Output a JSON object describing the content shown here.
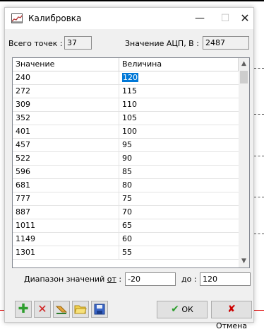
{
  "window": {
    "title": "Калибровка",
    "minimize_glyph": "—",
    "maximize_glyph": "☐",
    "close_glyph": "✕"
  },
  "info": {
    "points_label": "Всего точек :",
    "points_value": "37",
    "adc_label": "Значение АЦП, В :",
    "adc_value": "2487"
  },
  "table": {
    "columns": [
      "Значение",
      "Величина"
    ],
    "rows": [
      [
        "240",
        "120"
      ],
      [
        "272",
        "115"
      ],
      [
        "309",
        "110"
      ],
      [
        "352",
        "105"
      ],
      [
        "401",
        "100"
      ],
      [
        "457",
        "95"
      ],
      [
        "522",
        "90"
      ],
      [
        "596",
        "85"
      ],
      [
        "681",
        "80"
      ],
      [
        "777",
        "75"
      ],
      [
        "887",
        "70"
      ],
      [
        "1011",
        "65"
      ],
      [
        "1149",
        "60"
      ],
      [
        "1301",
        "55"
      ]
    ],
    "selected_row": 0
  },
  "range": {
    "label_prefix": "Диапазон значений ",
    "label_underlined": "от",
    "label_suffix": " :",
    "from_value": "-20",
    "to_label": "до :",
    "to_value": "120"
  },
  "toolbar": {
    "icons": [
      "add-row-icon",
      "delete-row-icon",
      "clear-icon",
      "open-file-icon",
      "save-icon"
    ],
    "ok_label": "ОК",
    "cancel_label": "Отмена"
  },
  "colors": {
    "selection": "#0078d7",
    "ok_check": "#2e9e2e",
    "cancel_x": "#cc0000"
  }
}
